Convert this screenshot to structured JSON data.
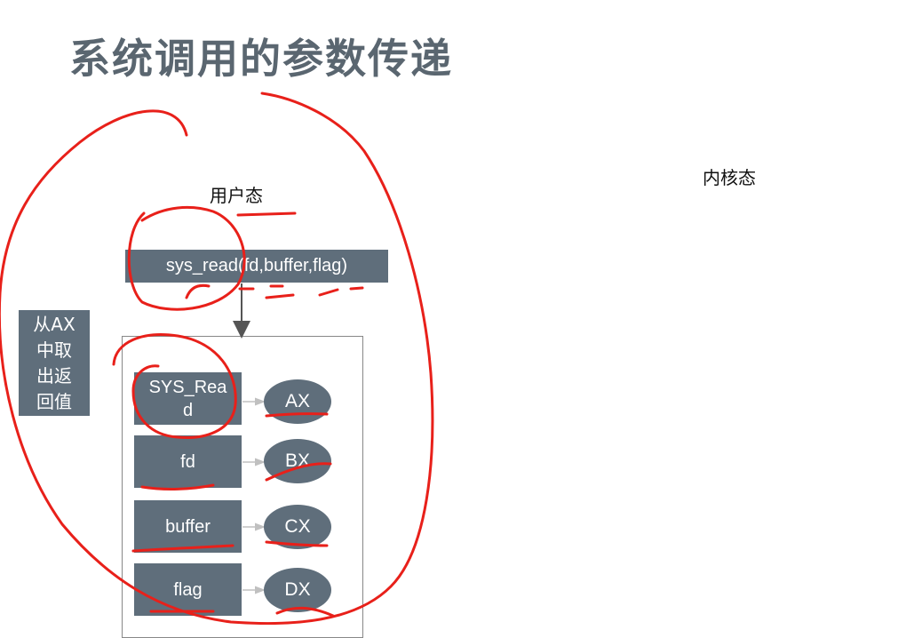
{
  "title": "系统调用的参数传递",
  "user_mode_label": "用户态",
  "kernel_mode_label": "内核态",
  "call_signature": "sys_read(fd,buffer,flag)",
  "ax_note_lines": [
    "从AX",
    "中取",
    "出返",
    "回值"
  ],
  "params": [
    {
      "name": "SYS_Read",
      "register": "AX"
    },
    {
      "name": "fd",
      "register": "BX"
    },
    {
      "name": "buffer",
      "register": "CX"
    },
    {
      "name": "flag",
      "register": "DX"
    }
  ],
  "colors": {
    "box_fill": "#5f6e7b",
    "title_color": "#5a6670",
    "annotation_red": "#e8201a"
  }
}
